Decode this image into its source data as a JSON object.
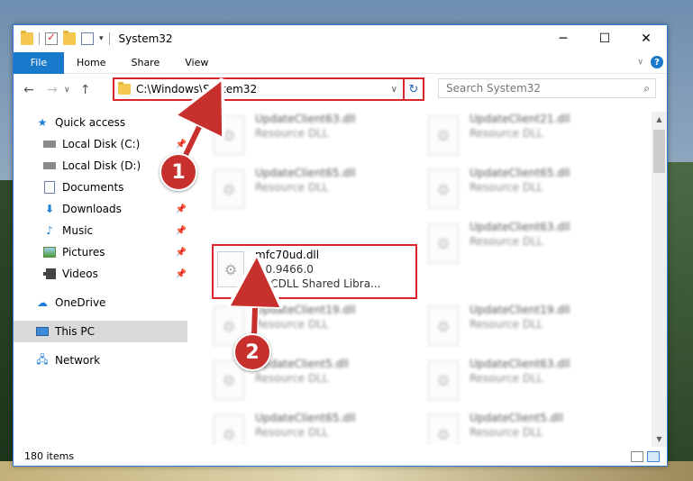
{
  "window": {
    "title": "System32"
  },
  "ribbon": {
    "tabs": [
      "File",
      "Home",
      "Share",
      "View"
    ]
  },
  "navbar": {
    "address": "C:\\Windows\\System32",
    "search_placeholder": "Search System32"
  },
  "sidebar": {
    "items": [
      {
        "label": "Quick access",
        "icon": "star-icon"
      },
      {
        "label": "Local Disk (C:)",
        "icon": "disk-icon",
        "pinned": true
      },
      {
        "label": "Local Disk (D:)",
        "icon": "disk-icon",
        "pinned": false
      },
      {
        "label": "Documents",
        "icon": "documents-icon",
        "pinned": true
      },
      {
        "label": "Downloads",
        "icon": "downloads-icon",
        "pinned": true
      },
      {
        "label": "Music",
        "icon": "music-icon",
        "pinned": true
      },
      {
        "label": "Pictures",
        "icon": "pictures-icon",
        "pinned": true
      },
      {
        "label": "Videos",
        "icon": "videos-icon",
        "pinned": true
      },
      {
        "label": "OneDrive",
        "icon": "cloud-icon"
      },
      {
        "label": "This PC",
        "icon": "pc-icon",
        "selected": true
      },
      {
        "label": "Network",
        "icon": "network-icon"
      }
    ]
  },
  "files": {
    "left": [
      {
        "name": "UpdateClient63.dll",
        "sub": "Resource DLL"
      },
      {
        "name": "UpdateClient65.dll",
        "sub": "Resource DLL"
      },
      {
        "name": "mfc70ud.dll",
        "sub": "7.0.9466.0",
        "sub2": "MFCDLL Shared Libra..."
      },
      {
        "name": "UpdateClient19.dll",
        "sub": "Resource DLL"
      },
      {
        "name": "UpdateClient5.dll",
        "sub": "Resource DLL"
      },
      {
        "name": "UpdateClient65.dll",
        "sub": "Resource DLL"
      }
    ],
    "right": [
      {
        "name": "UpdateClient21.dll",
        "sub": "Resource DLL"
      },
      {
        "name": "UpdateClient65.dll",
        "sub": "Resource DLL"
      },
      {
        "name": "UpdateClient63.dll",
        "sub": "Resource DLL"
      },
      {
        "name": "UpdateClient19.dll",
        "sub": "Resource DLL"
      },
      {
        "name": "UpdateClient63.dll",
        "sub": "Resource DLL"
      },
      {
        "name": "UpdateClient5.dll",
        "sub": "Resource DLL"
      }
    ]
  },
  "status": {
    "count": "180 items"
  },
  "callouts": {
    "one": "1",
    "two": "2"
  },
  "colors": {
    "accent": "#1979ca",
    "highlight_border": "#d9262a",
    "callout": "#c7302c"
  }
}
